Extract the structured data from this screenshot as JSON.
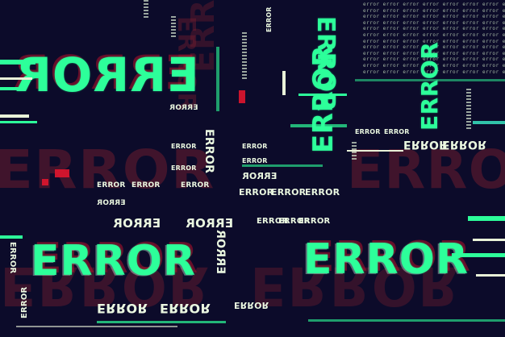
{
  "word": "ERROR",
  "colors": {
    "background": "#0c0b2a",
    "primary_green": "#2dff9a",
    "glitch_red": "#b3122a",
    "highlight_white": "#f2fff4"
  }
}
